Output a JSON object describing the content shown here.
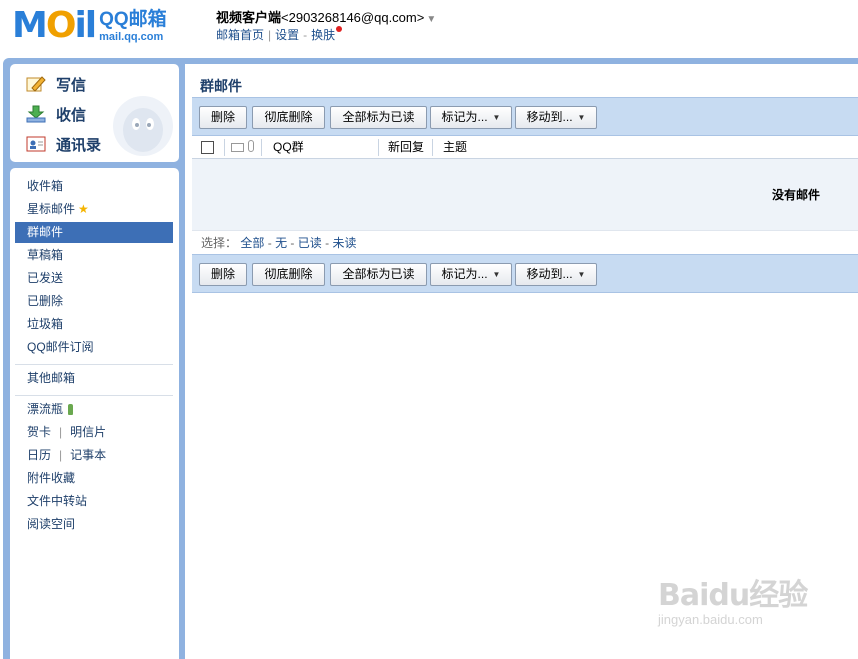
{
  "logo": {
    "mail_letters": [
      "M",
      "O",
      "i",
      "l"
    ],
    "brand": "QQ邮箱",
    "domain": "mail.qq.com"
  },
  "header": {
    "user_name": "视频客户端",
    "user_email": "<2903268146@qq.com>",
    "links": {
      "home": "邮箱首页",
      "settings": "设置",
      "skin": "换肤"
    },
    "separator": "|",
    "dash": "-"
  },
  "actions": {
    "compose": "写信",
    "receive": "收信",
    "contacts": "通讯录"
  },
  "folders": {
    "inbox": "收件箱",
    "starred": "星标邮件",
    "group": "群邮件",
    "drafts": "草稿箱",
    "sent": "已发送",
    "deleted": "已删除",
    "spam": "垃圾箱",
    "subscriptions": "QQ邮件订阅",
    "other": "其他邮箱",
    "bottle": "漂流瓶",
    "card": "贺卡",
    "postcard": "明信片",
    "calendar": "日历",
    "notes": "记事本",
    "attachments": "附件收藏",
    "transfer": "文件中转站",
    "reading": "阅读空间"
  },
  "main": {
    "title": "群邮件",
    "toolbar": {
      "delete": "删除",
      "permanent_delete": "彻底删除",
      "mark_all_read": "全部标为已读",
      "mark_as": "标记为...",
      "move_to": "移动到..."
    },
    "columns": {
      "group": "QQ群",
      "new_reply": "新回复",
      "subject": "主题"
    },
    "empty_message": "没有邮件",
    "select": {
      "label": "选择：",
      "all": "全部",
      "none": "无",
      "read": "已读",
      "unread": "未读"
    }
  },
  "watermark": {
    "big": "Baidu经验",
    "small": "jingyan.baidu.com"
  },
  "colors": {
    "accent": "#3d6fb6",
    "frame": "#8fb2e0",
    "toolbar": "#c7dbf2",
    "link": "#1e4f8c"
  }
}
